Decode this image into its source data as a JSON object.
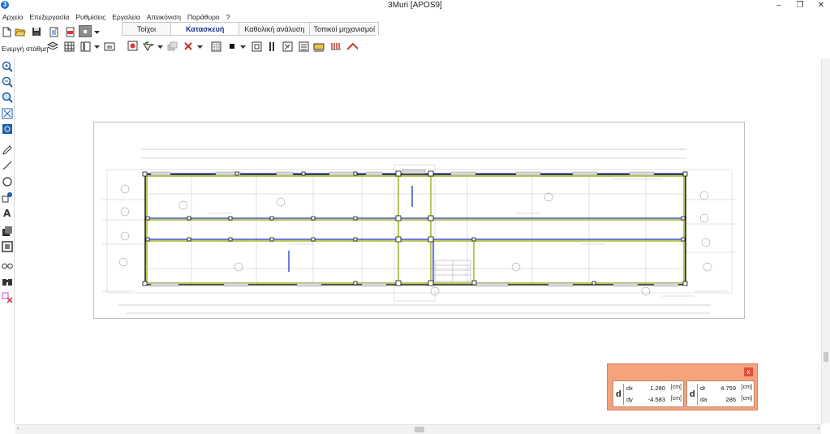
{
  "window": {
    "title": "3Muri  [APOS9]",
    "app_icon_glyph": "3"
  },
  "menu": [
    "Αρχείο",
    "Επεξεργασία",
    "Ρυθμίσεις",
    "Εργαλεία",
    "Απεικόνιση",
    "Παράθυρο",
    "?"
  ],
  "tabs": [
    {
      "label": "Τοίχοι",
      "active": false
    },
    {
      "label": "Κατασκευή",
      "active": true
    },
    {
      "label": "Καθολική ανάλυση",
      "active": false
    },
    {
      "label": "Τοπικοί μηχανισμοί",
      "active": false
    }
  ],
  "toolbar2": {
    "layer_label": "Ενεργή στάθμη"
  },
  "coord_panel": {
    "close": "x",
    "d_glyph": "d",
    "dx": {
      "label": "dx",
      "value": "1.280",
      "unit": "[cm]"
    },
    "dy": {
      "label": "dy",
      "value": "-4.583",
      "unit": "[cm]"
    },
    "dr": {
      "label": "dr",
      "value": "4.759",
      "unit": "[cm]"
    },
    "da": {
      "label": "da",
      "value": "286",
      "unit": "[cm]"
    }
  },
  "colors": {
    "accent_tab": "#1a2e8f",
    "panel_bg": "#f4a37d",
    "close_red": "#e0503a",
    "wall_blue": "#2336c8",
    "wall_green": "#b7c95a"
  }
}
